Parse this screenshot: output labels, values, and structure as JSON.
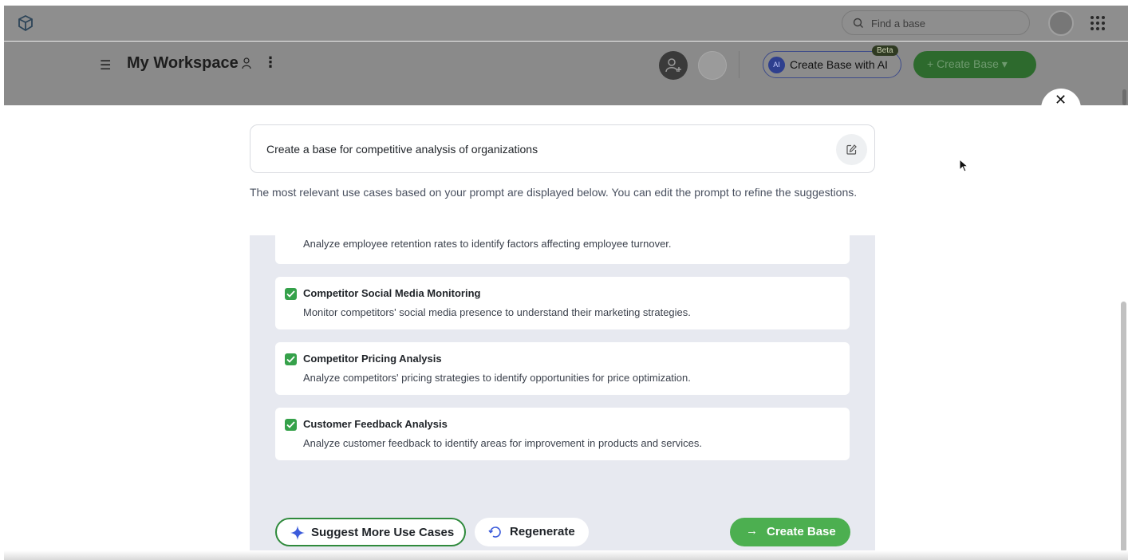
{
  "topbar": {
    "search_placeholder": "Find a base"
  },
  "workspace": {
    "title": "My Workspace",
    "create_ai_label": "Create Base with AI",
    "beta_label": "Beta",
    "create_base_label": "+ Create Base ▾"
  },
  "modal": {
    "close_label": "✕",
    "prompt_text": "Create a base for competitive analysis of organizations",
    "description": "The most relevant use cases based on your prompt are displayed below. You can edit the prompt to refine the suggestions.",
    "use_cases": [
      {
        "title": "",
        "description": "Analyze employee retention rates to identify factors affecting employee turnover.",
        "checked": true
      },
      {
        "title": "Competitor Social Media Monitoring",
        "description": "Monitor competitors' social media presence to understand their marketing strategies.",
        "checked": true
      },
      {
        "title": "Competitor Pricing Analysis",
        "description": "Analyze competitors' pricing strategies to identify opportunities for price optimization.",
        "checked": true
      },
      {
        "title": "Customer Feedback Analysis",
        "description": "Analyze customer feedback to identify areas for improvement in products and services.",
        "checked": true
      }
    ],
    "suggest_label": "Suggest More Use Cases",
    "regenerate_label": "Regenerate",
    "create_label": "Create Base",
    "create_arrow": "→"
  },
  "colors": {
    "accent_green": "#4caf50",
    "checkbox_green": "#35a14a",
    "list_bg": "#e7e9f0"
  }
}
